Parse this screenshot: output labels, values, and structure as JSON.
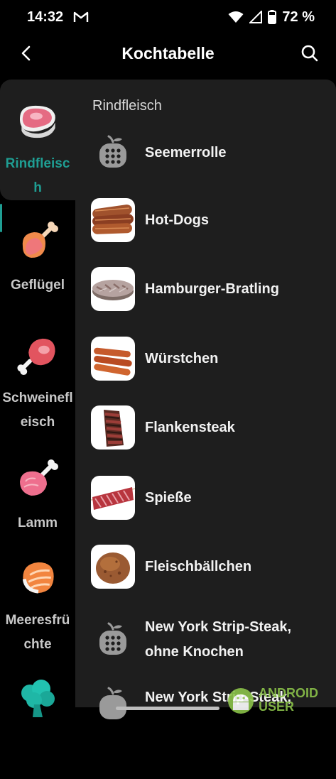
{
  "status_bar": {
    "time": "14:32",
    "battery": "72 %"
  },
  "app_bar": {
    "title": "Kochtabelle"
  },
  "sidebar": {
    "categories": [
      {
        "label": "Rindfleisch",
        "active": true
      },
      {
        "label": "Geflügel"
      },
      {
        "label": "Schweinefleisch"
      },
      {
        "label": "Lamm"
      },
      {
        "label": "Meeresfrüchte"
      }
    ]
  },
  "content": {
    "section_title": "Rindfleisch",
    "items": [
      {
        "label": "Seemerrolle",
        "icon": "placeholder-food-icon"
      },
      {
        "label": "Hot-Dogs",
        "icon": "hot-dogs-image"
      },
      {
        "label": "Hamburger-Bratling",
        "icon": "hamburger-patty-image"
      },
      {
        "label": "Würstchen",
        "icon": "sausages-image"
      },
      {
        "label": "Flankensteak",
        "icon": "flank-steak-image"
      },
      {
        "label": "Spieße",
        "icon": "skewers-image"
      },
      {
        "label": "Fleischbällchen",
        "icon": "meatballs-image"
      },
      {
        "label": "New York Strip-Steak, ohne Knochen",
        "icon": "placeholder-food-icon"
      },
      {
        "label": "New York Strip-Steak,",
        "icon": "placeholder-food-icon"
      }
    ]
  },
  "watermark": {
    "line1": "ANDROID",
    "line2": "USER"
  },
  "colors": {
    "accent": "#1f9e93",
    "panel": "#1e1e1e",
    "background": "#000000"
  }
}
